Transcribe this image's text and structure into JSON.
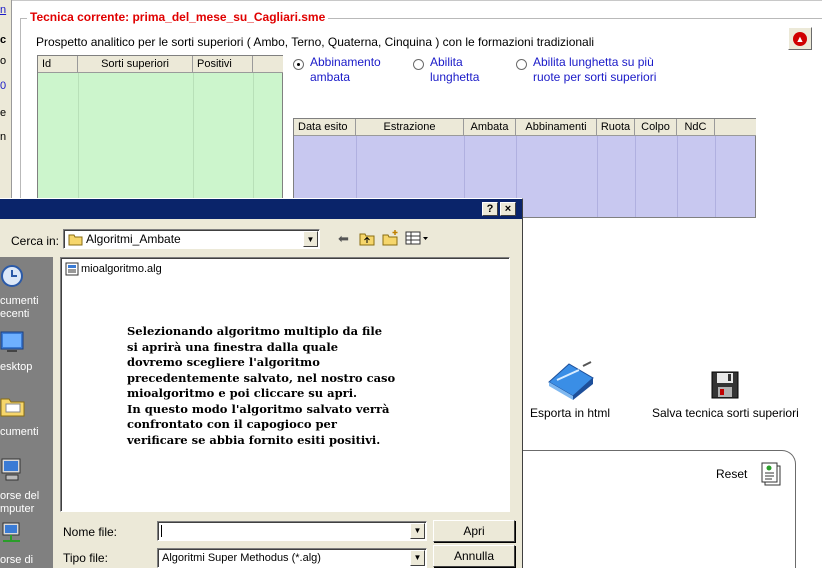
{
  "left_strip": [
    "n",
    "c",
    "o",
    "0",
    "e",
    "n"
  ],
  "groupbox": {
    "title": "Tecnica corrente: prima_del_mese_su_Cagliari.sme",
    "subtitle": "Prospetto analitico per le sorti superiori ( Ambo, Terno, Quaterna, Cinquina ) con le formazioni tradizionali"
  },
  "green_table": {
    "columns": [
      "Id",
      "Sorti superiori",
      "Positivi",
      ""
    ]
  },
  "radios": [
    {
      "label_line1": "Abbinamento",
      "label_line2": "ambata",
      "checked": true
    },
    {
      "label_line1": "Abilita",
      "label_line2": "lunghetta",
      "checked": false
    },
    {
      "label_line1": "Abilita lunghetta su più",
      "label_line2": "ruote per sorti superiori",
      "checked": false
    }
  ],
  "blue_table": {
    "columns": [
      "Data esito",
      "Estrazione",
      "Ambata",
      "Abbinamenti",
      "Ruota",
      "Colpo",
      "NdC",
      ""
    ]
  },
  "actions": {
    "export_html": "Esporta in html",
    "save_technique": "Salva tecnica sorti superiori",
    "reset": "Reset"
  },
  "dialog": {
    "help_btn": "?",
    "close_btn": "×",
    "look_in_label": "Cerca in:",
    "look_in_value": "Algoritmi_Ambate",
    "places": [
      {
        "line1": "cumenti",
        "line2": "ecenti"
      },
      {
        "line1": "esktop",
        "line2": ""
      },
      {
        "line1": "cumenti",
        "line2": ""
      },
      {
        "line1": "orse del",
        "line2": "mputer"
      },
      {
        "line1": "orse di rete",
        "line2": ""
      }
    ],
    "file_name": "mioalgoritmo.alg",
    "overlay_text": "Selezionando algoritmo multiplo da file\nsi aprirà una finestra dalla quale\ndovremo scegliere l'algoritmo\nprecedentemente salvato, nel nostro caso\nmioalgoritmo e poi cliccare su apri.\nIn questo modo l'algoritmo salvato verrà\nconfrontato con il capogioco per\nverificare se abbia fornito esiti positivi.",
    "filename_label": "Nome file:",
    "filename_value": "",
    "filetype_label": "Tipo file:",
    "filetype_value": "Algoritmi Super Methodus (*.alg)",
    "open_btn": "Apri",
    "cancel_btn": "Annulla"
  }
}
